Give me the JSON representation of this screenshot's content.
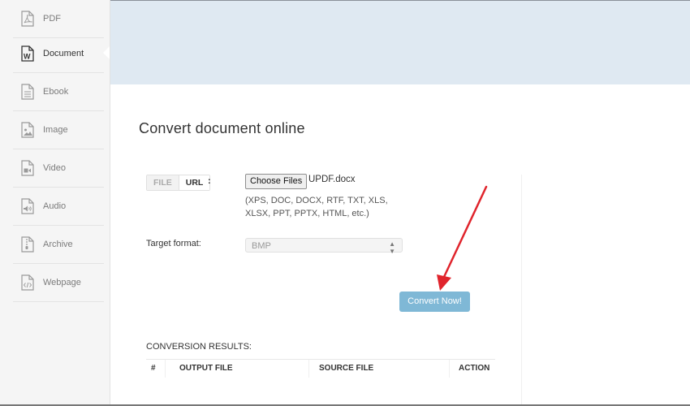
{
  "sidebar": {
    "items": [
      {
        "label": "PDF",
        "icon": "pdf-file-icon",
        "active": false
      },
      {
        "label": "Document",
        "icon": "word-document-icon",
        "active": true
      },
      {
        "label": "Ebook",
        "icon": "ebook-file-icon",
        "active": false
      },
      {
        "label": "Image",
        "icon": "image-file-icon",
        "active": false
      },
      {
        "label": "Video",
        "icon": "video-file-icon",
        "active": false
      },
      {
        "label": "Audio",
        "icon": "audio-file-icon",
        "active": false
      },
      {
        "label": "Archive",
        "icon": "archive-file-icon",
        "active": false
      },
      {
        "label": "Webpage",
        "icon": "webpage-file-icon",
        "active": false
      }
    ]
  },
  "main": {
    "title": "Convert document online",
    "source_tabs": {
      "file": "FILE",
      "url": "URL",
      "separator": ":"
    },
    "choose_files_label": "Choose Files",
    "selected_file": "UPDF.docx",
    "supported_formats_hint": "(XPS, DOC, DOCX, RTF, TXT, XLS, XLSX, PPT, PPTX, HTML, etc.)",
    "target_format_label": "Target format:",
    "target_format_value": "BMP",
    "convert_button": "Convert Now!",
    "results_label": "CONVERSION RESULTS:",
    "table_headers": [
      "#",
      "OUTPUT FILE",
      "SOURCE FILE",
      "ACTION"
    ]
  },
  "colors": {
    "banner": "#dfe9f2",
    "convert_button": "#7fb8d6",
    "annotation_arrow": "#e0242c"
  }
}
